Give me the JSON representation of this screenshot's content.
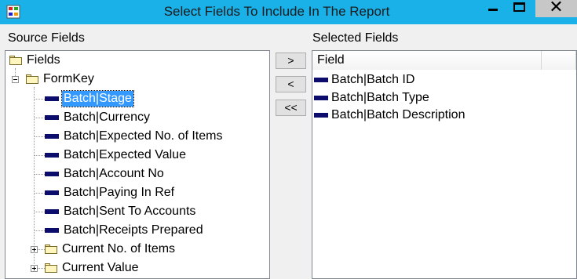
{
  "window": {
    "title": "Select Fields To Include In The Report",
    "minimize_glyph": "—",
    "maximize_glyph": "□",
    "close_glyph": "✕"
  },
  "source": {
    "label": "Source Fields",
    "root_label": "Fields",
    "group_label": "FormKey",
    "fields": [
      "Batch|Stage",
      "Batch|Currency",
      "Batch|Expected No. of Items",
      "Batch|Expected Value",
      "Batch|Account No",
      "Batch|Paying In Ref",
      "Batch|Sent To Accounts",
      "Batch|Receipts Prepared"
    ],
    "selected_field": "Batch|Stage",
    "subgroups": [
      "Current No. of Items",
      "Current Value"
    ]
  },
  "buttons": {
    "add": ">",
    "remove": "<",
    "remove_all": "<<"
  },
  "selected": {
    "label": "Selected Fields",
    "column_header": "Field",
    "items": [
      "Batch|Batch ID",
      "Batch|Batch Type",
      "Batch|Batch Description"
    ]
  },
  "colors": {
    "titlebar": "#1ab0e8",
    "selection": "#3399ff",
    "field_icon": "#0c0c6c"
  }
}
